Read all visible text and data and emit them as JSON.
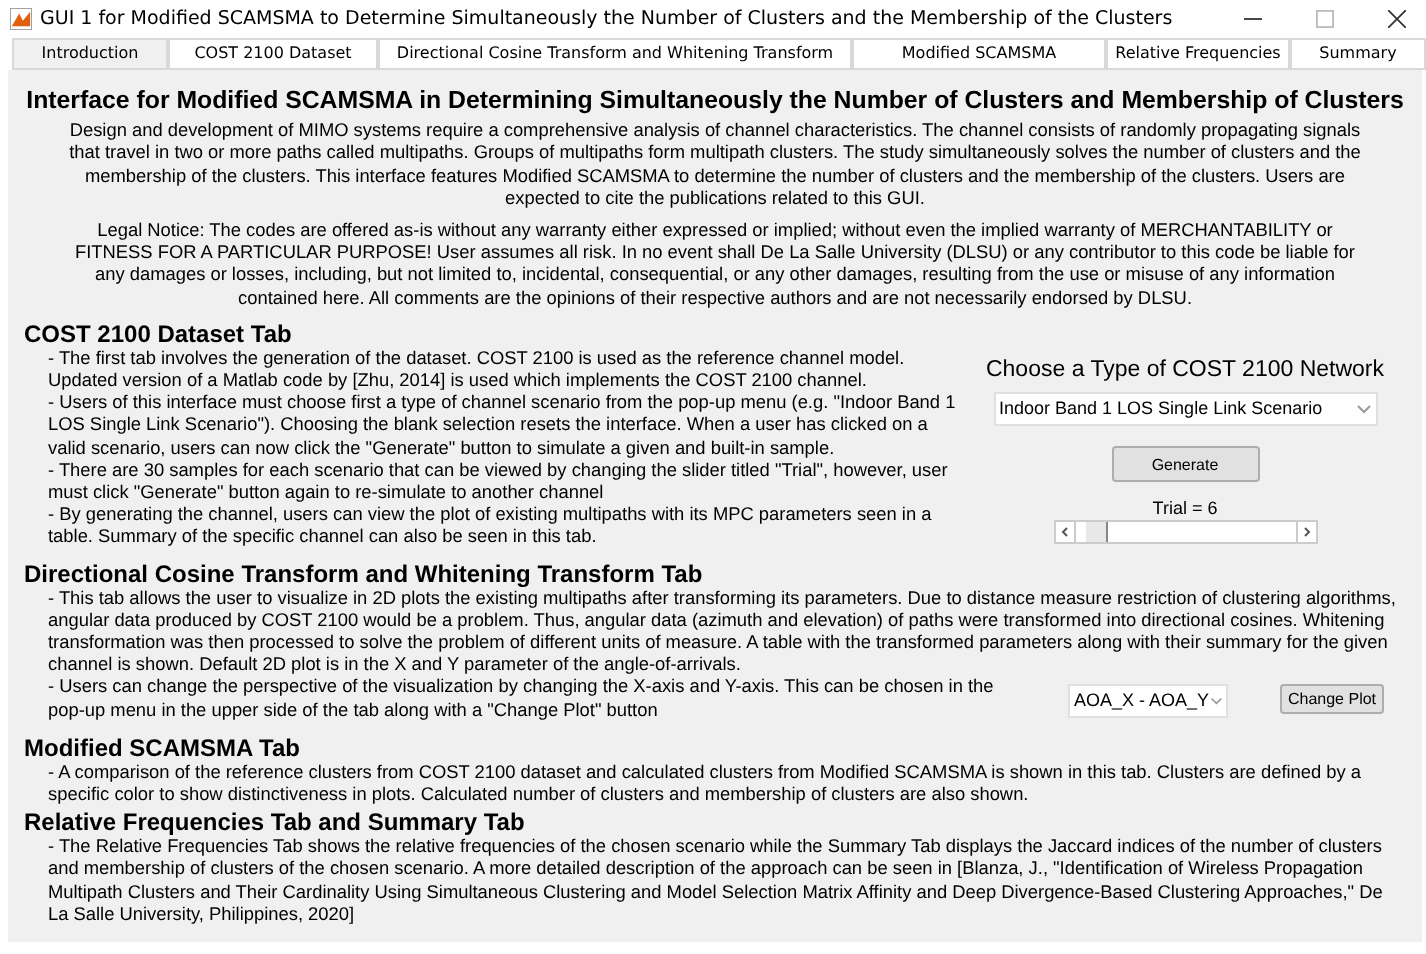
{
  "window": {
    "title": "GUI 1 for Modified SCAMSMA to Determine Simultaneously the Number of Clusters and the Membership of the Clusters"
  },
  "tabs": [
    {
      "label": "Introduction",
      "selected": true
    },
    {
      "label": "COST 2100 Dataset",
      "selected": false
    },
    {
      "label": "Directional Cosine Transform and Whitening Transform",
      "selected": false
    },
    {
      "label": "Modified SCAMSMA",
      "selected": false
    },
    {
      "label": "Relative Frequencies",
      "selected": false
    },
    {
      "label": "Summary",
      "selected": false
    }
  ],
  "intro": {
    "heading": "Interface for Modified SCAMSMA in Determining Simultaneously the Number of Clusters and Membership of Clusters",
    "description": "Design and development of MIMO systems require a comprehensive analysis of channel characteristics. The channel consists of randomly propagating signals that travel in two or more paths called multipaths. Groups of multipaths form multipath clusters. The study simultaneously solves the number of clusters and the membership of the clusters. This interface features Modified SCAMSMA to determine the number of clusters and the membership of the clusters. Users are expected to cite the publications related to this GUI.",
    "legal_notice": "Legal Notice: The codes are offered as-is without any warranty either expressed or implied; without even the implied warranty of MERCHANTABILITY or FITNESS FOR A PARTICULAR PURPOSE! User assumes all risk. In no event shall De La Salle University (DLSU) or any contributor to this code be liable for any damages or losses, including, but not limited to, incidental, consequential, or any other damages, resulting from the use or misuse of any information contained here. All comments are the opinions of their respective authors and are not necessarily endorsed by DLSU."
  },
  "cost_section": {
    "heading": "COST 2100 Dataset Tab",
    "paragraphs": [
      "- The first tab involves the generation of the dataset. COST 2100 is used as the reference channel model. Updated version of a Matlab code by [Zhu, 2014] is used which implements the COST 2100 channel.",
      "- Users of this interface must choose first a type of channel scenario from the pop-up menu (e.g. \"Indoor Band 1 LOS Single Link Scenario\"). Choosing the blank selection resets the interface. When a user has clicked on a valid scenario, users can now click the \"Generate\" button to simulate a given and built-in sample.",
      "- There are 30 samples for each scenario that can be viewed by changing the slider titled \"Trial\", however, user must click \"Generate\" button again to re-simulate to another channel",
      "- By generating the channel, users can view the plot of existing multipaths with its MPC parameters seen in a table. Summary of the specific channel can also be seen in this tab."
    ],
    "network_label": "Choose a Type of COST 2100 Network",
    "network_menu": {
      "value": "Indoor Band 1 LOS Single Link Scenario"
    },
    "generate_button": "Generate",
    "trial_label": "Trial =  6",
    "trial_slider": {
      "level": 0.05
    }
  },
  "dct_section": {
    "heading": "Directional Cosine Transform and Whitening Transform Tab",
    "paragraphs": [
      "- This tab allows the user to visualize in 2D plots the existing multipaths after transforming its parameters. Due to distance measure restriction of clustering algorithms, angular data produced by COST 2100 would be a problem. Thus, angular data (azimuth and elevation) of paths were transformed into directional cosines. Whitening transformation was then processed to solve the problem of different units of measure. A table with the transformed parameters along with their summary for the given channel is shown. Default 2D plot is in the X and Y parameter of the angle-of-arrivals."
    ],
    "note": "- Users can change the perspective of the visualization by changing the X-axis and Y-axis. This can be chosen in the pop-up menu in the upper side of the tab along with a \"Change Plot\" button",
    "plot_menu": {
      "value": "AOA_X - AOA_Y"
    },
    "change_plot_button": "Change Plot"
  },
  "sections": [
    {
      "heading": "Modified SCAMSMA Tab",
      "paragraphs": [
        "- A comparison of the reference clusters from COST 2100 dataset and calculated clusters from Modified SCAMSMA is shown in this tab. Clusters are defined by a specific color to show distinctiveness in plots. Calculated number of clusters and membership of clusters are also shown."
      ]
    },
    {
      "heading": "Relative Frequencies Tab and Summary Tab",
      "paragraphs": [
        "- The Relative Frequencies Tab shows the relative frequencies of the chosen scenario while the Summary Tab displays the Jaccard indices of the number of clusters and membership of clusters of the chosen scenario. A more detailed description of the approach can be seen in [Blanza, J., \"Identification of Wireless Propagation Multipath Clusters and Their Cardinality Using Simultaneous Clustering and Model Selection Matrix Affinity and Deep Divergence-Based Clustering Approaches,\" De La Salle University, Philippines, 2020]"
      ]
    }
  ]
}
